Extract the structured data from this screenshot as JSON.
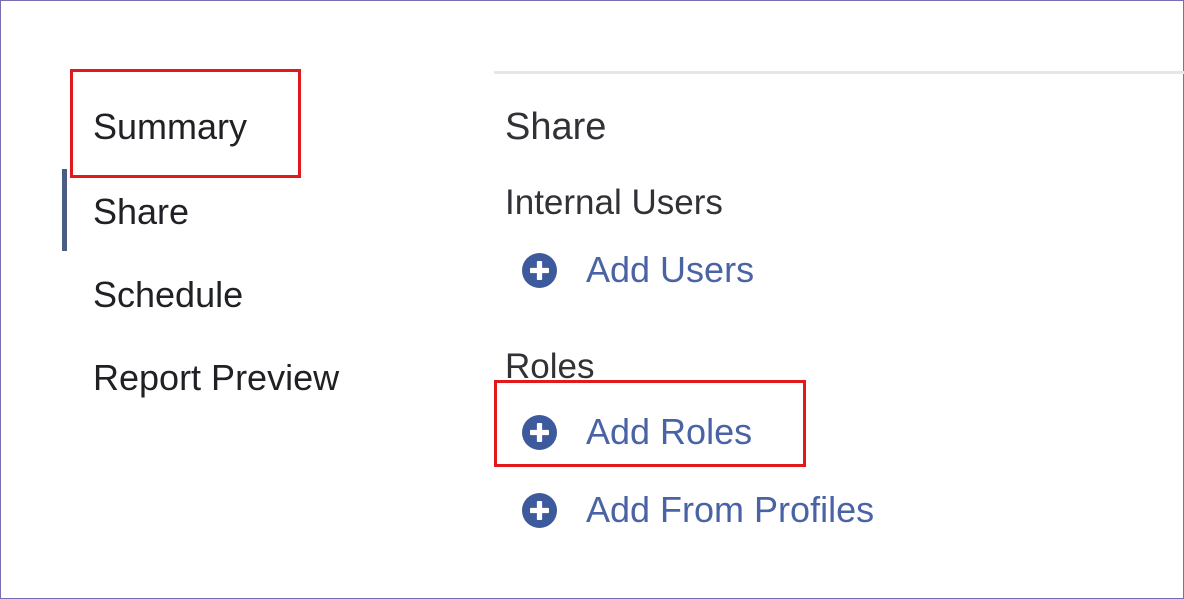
{
  "nav": {
    "items": [
      {
        "label": "Summary",
        "active": false
      },
      {
        "label": "Share",
        "active": true
      },
      {
        "label": "Schedule",
        "active": false
      },
      {
        "label": "Report Preview",
        "active": false
      }
    ]
  },
  "panel": {
    "title": "Share",
    "internal_users": {
      "label": "Internal Users",
      "add_users_label": "Add Users"
    },
    "roles": {
      "label": "Roles",
      "add_roles_label": "Add Roles",
      "add_from_profiles_label": "Add From Profiles"
    }
  },
  "icons": {
    "add": "plus-circle-icon"
  },
  "colors": {
    "link": "#4a63a5",
    "icon": "#3d5a9c",
    "active_indicator": "#4a5d83",
    "highlight": "#e1191b",
    "frame": "#7b6bb0"
  }
}
